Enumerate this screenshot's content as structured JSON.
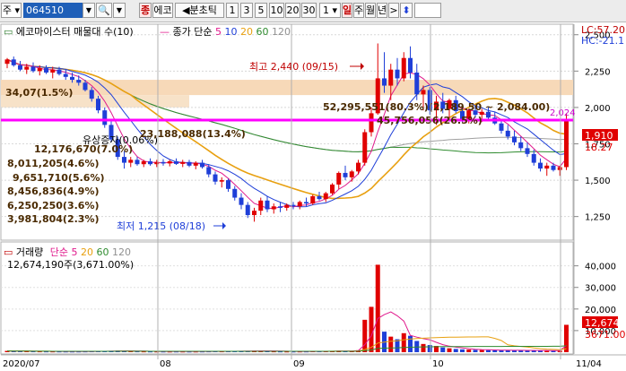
{
  "toolbar": {
    "market": "주",
    "code": "064510",
    "tab_red": "종",
    "stock_name": "에코",
    "period_label": "분초틱",
    "intervals": [
      "1",
      "3",
      "5",
      "10",
      "20",
      "30"
    ],
    "interval_value": "1",
    "period_buttons": [
      "일",
      "주",
      "월",
      "년"
    ]
  },
  "price_panel": {
    "legend_title": "에코마이스터 매물대 수(10)",
    "ma_label": "종가 단순",
    "ma_periods": [
      "5",
      "10",
      "20",
      "60",
      "120"
    ],
    "ma_colors": [
      "#e0198c",
      "#1f3fd8",
      "#e8a010",
      "#2e8b2e",
      "#a0a0a0"
    ],
    "lc_label": "LC:57.20",
    "hc_label": "HC:-21.1",
    "high_annotation": "최고 2,440 (09/15)",
    "low_annotation": "최저 1,215 (08/18)",
    "line_value": "2,024",
    "current_price": "1,910",
    "second_box": "18.27",
    "volume_profile_labels": [
      "52,295,551(80.3%)(2,189.50 ~ 2,084.00)",
      "45,756,056(26.5%)",
      "유상증자(0.06%)",
      "23,188,088(13.4%)",
      "12,176,670(7.0%)",
      "8,011,205(4.6%)",
      "9,651,710(5.6%)",
      "8,456,836(4.9%)",
      "6,250,250(3.6%)",
      "3,981,804(2.3%)",
      "34,07(1.5%)"
    ],
    "y_ticks": [
      "2,500",
      "2,250",
      "2,000",
      "1,750",
      "1,500",
      "1,250"
    ],
    "y_range": [
      1100,
      2560
    ]
  },
  "volume_panel": {
    "legend_title": "거래량",
    "ma_label": "단순",
    "ma_periods": [
      "5",
      "20",
      "60",
      "120"
    ],
    "ma_colors": [
      "#e0198c",
      "#e8a010",
      "#2e8b2e",
      "#a0a0a0"
    ],
    "value_text": "12,674,190주(3,671.00%)",
    "current_box": "12,674",
    "second_box": "3671.00",
    "y_ticks": [
      "40,000",
      "30,000",
      "20,000",
      "10,000"
    ],
    "y_range": [
      0,
      44000
    ]
  },
  "x_axis": {
    "labels": [
      "2020/07",
      "08",
      "09",
      "10",
      "11/04"
    ]
  },
  "chart_data": {
    "type": "candlestick",
    "unit_price": "KRW",
    "unit_volume": "thousand shares",
    "candles": [
      [
        2300,
        2340,
        2270,
        2330,
        600
      ],
      [
        2330,
        2350,
        2280,
        2290,
        500
      ],
      [
        2290,
        2320,
        2250,
        2260,
        450
      ],
      [
        2260,
        2300,
        2230,
        2280,
        420
      ],
      [
        2280,
        2310,
        2240,
        2250,
        400
      ],
      [
        2250,
        2290,
        2220,
        2270,
        380
      ],
      [
        2270,
        2290,
        2230,
        2240,
        360
      ],
      [
        2240,
        2280,
        2200,
        2260,
        350
      ],
      [
        2260,
        2280,
        2220,
        2230,
        340
      ],
      [
        2230,
        2260,
        2190,
        2210,
        330
      ],
      [
        2210,
        2240,
        2170,
        2190,
        320
      ],
      [
        2190,
        2220,
        2150,
        2170,
        330
      ],
      [
        2170,
        2190,
        2110,
        2120,
        360
      ],
      [
        2120,
        2140,
        2040,
        2060,
        400
      ],
      [
        2060,
        2080,
        1960,
        1980,
        430
      ],
      [
        1980,
        2000,
        1860,
        1880,
        520
      ],
      [
        1880,
        1910,
        1760,
        1780,
        650
      ],
      [
        1780,
        1800,
        1640,
        1660,
        720
      ],
      [
        1660,
        1700,
        1580,
        1620,
        560
      ],
      [
        1620,
        1660,
        1590,
        1640,
        430
      ],
      [
        1640,
        1660,
        1600,
        1610,
        390
      ],
      [
        1610,
        1640,
        1590,
        1630,
        360
      ],
      [
        1630,
        1650,
        1600,
        1610,
        340
      ],
      [
        1610,
        1640,
        1590,
        1625,
        330
      ],
      [
        1625,
        1645,
        1600,
        1615,
        320
      ],
      [
        1615,
        1640,
        1595,
        1630,
        310
      ],
      [
        1630,
        1650,
        1605,
        1612,
        330
      ],
      [
        1612,
        1640,
        1590,
        1625,
        320
      ],
      [
        1625,
        1640,
        1590,
        1600,
        310
      ],
      [
        1600,
        1630,
        1575,
        1620,
        320
      ],
      [
        1620,
        1640,
        1580,
        1590,
        340
      ],
      [
        1590,
        1610,
        1520,
        1540,
        380
      ],
      [
        1540,
        1560,
        1470,
        1490,
        420
      ],
      [
        1490,
        1520,
        1450,
        1500,
        390
      ],
      [
        1500,
        1510,
        1420,
        1440,
        410
      ],
      [
        1440,
        1460,
        1360,
        1380,
        460
      ],
      [
        1380,
        1410,
        1300,
        1330,
        520
      ],
      [
        1330,
        1350,
        1240,
        1260,
        610
      ],
      [
        1260,
        1310,
        1215,
        1290,
        700
      ],
      [
        1290,
        1380,
        1260,
        1360,
        650
      ],
      [
        1360,
        1390,
        1280,
        1300,
        480
      ],
      [
        1300,
        1340,
        1270,
        1320,
        380
      ],
      [
        1320,
        1350,
        1280,
        1310,
        350
      ],
      [
        1310,
        1340,
        1290,
        1330,
        330
      ],
      [
        1330,
        1350,
        1300,
        1320,
        320
      ],
      [
        1320,
        1360,
        1300,
        1350,
        340
      ],
      [
        1350,
        1380,
        1320,
        1340,
        350
      ],
      [
        1340,
        1400,
        1330,
        1390,
        420
      ],
      [
        1390,
        1420,
        1360,
        1370,
        400
      ],
      [
        1370,
        1420,
        1350,
        1410,
        430
      ],
      [
        1410,
        1480,
        1400,
        1470,
        520
      ],
      [
        1470,
        1560,
        1440,
        1550,
        680
      ],
      [
        1550,
        1600,
        1500,
        1520,
        600
      ],
      [
        1520,
        1570,
        1490,
        1560,
        540
      ],
      [
        1560,
        1640,
        1540,
        1620,
        900
      ],
      [
        1620,
        1850,
        1600,
        1830,
        15000
      ],
      [
        1830,
        2000,
        1800,
        1960,
        21000
      ],
      [
        1960,
        2440,
        1950,
        2200,
        40500
      ],
      [
        2200,
        2380,
        2100,
        2150,
        9500
      ],
      [
        2150,
        2300,
        2050,
        2260,
        7200
      ],
      [
        2260,
        2340,
        2150,
        2200,
        6000
      ],
      [
        2200,
        2380,
        2180,
        2340,
        8800
      ],
      [
        2340,
        2420,
        2200,
        2240,
        7600
      ],
      [
        2240,
        2300,
        2050,
        2090,
        5200
      ],
      [
        2090,
        2150,
        1980,
        2120,
        3800
      ],
      [
        2120,
        2140,
        1950,
        1980,
        3300
      ],
      [
        1980,
        2080,
        1880,
        2040,
        2900
      ],
      [
        2040,
        2100,
        1960,
        1990,
        2200
      ],
      [
        1990,
        2060,
        1930,
        2050,
        1800
      ],
      [
        2050,
        2080,
        1960,
        1975,
        1500
      ],
      [
        1975,
        2020,
        1900,
        1920,
        1300
      ],
      [
        1920,
        1990,
        1890,
        1980,
        1200
      ],
      [
        1980,
        2010,
        1930,
        1950,
        1100
      ],
      [
        1950,
        1990,
        1900,
        1970,
        1000
      ],
      [
        1970,
        2000,
        1920,
        1930,
        950
      ],
      [
        1930,
        1970,
        1880,
        1890,
        900
      ],
      [
        1890,
        1920,
        1820,
        1840,
        880
      ],
      [
        1840,
        1880,
        1780,
        1800,
        860
      ],
      [
        1800,
        1840,
        1740,
        1760,
        840
      ],
      [
        1760,
        1800,
        1700,
        1720,
        820
      ],
      [
        1720,
        1760,
        1660,
        1680,
        800
      ],
      [
        1680,
        1710,
        1600,
        1620,
        780
      ],
      [
        1620,
        1650,
        1560,
        1580,
        760
      ],
      [
        1580,
        1620,
        1530,
        1600,
        740
      ],
      [
        1600,
        1620,
        1560,
        1570,
        720
      ],
      [
        1570,
        1600,
        1530,
        1590,
        700
      ],
      [
        1590,
        1960,
        1570,
        1910,
        12674
      ]
    ]
  }
}
